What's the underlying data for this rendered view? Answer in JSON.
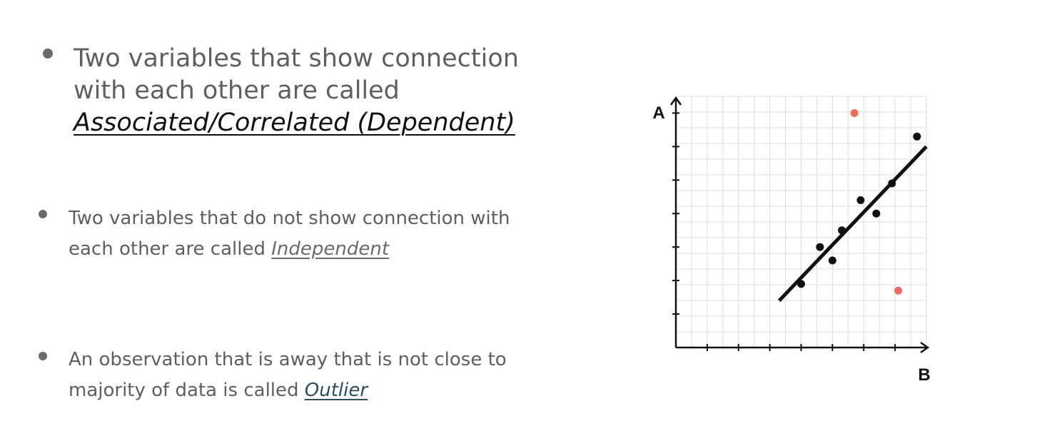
{
  "bullets": [
    {
      "text": "Two variables that show connection with each other are called ",
      "emphasis": "Associated/Correlated (Dependent)"
    },
    {
      "text": "Two variables that do not show connection with each other are called ",
      "emphasis": "Independent"
    },
    {
      "text": "An observation that is away that is not close to majority of data is called ",
      "emphasis": "Outlier"
    }
  ],
  "chart_data": {
    "type": "scatter",
    "xlabel": "B",
    "ylabel": "A",
    "xlim": [
      0,
      8
    ],
    "ylim": [
      0,
      7.5
    ],
    "grid": true,
    "series": [
      {
        "points": [
          [
            4.0,
            1.9
          ],
          [
            4.6,
            3.0
          ],
          [
            5.0,
            2.6
          ],
          [
            5.3,
            3.5
          ],
          [
            5.9,
            4.4
          ],
          [
            6.4,
            4.0
          ],
          [
            6.9,
            4.9
          ],
          [
            7.7,
            6.3
          ]
        ],
        "color": "#111111"
      },
      {
        "points": [
          [
            5.7,
            7.0
          ],
          [
            7.1,
            1.7
          ]
        ],
        "color": "#ef6b5e"
      }
    ],
    "trendline": {
      "from": [
        3.3,
        1.4
      ],
      "to": [
        8.0,
        6.0
      ]
    },
    "colors": {
      "grid": "#dddddd",
      "axis": "#111111",
      "point": "#111111",
      "outlier": "#ef6b5e"
    }
  }
}
